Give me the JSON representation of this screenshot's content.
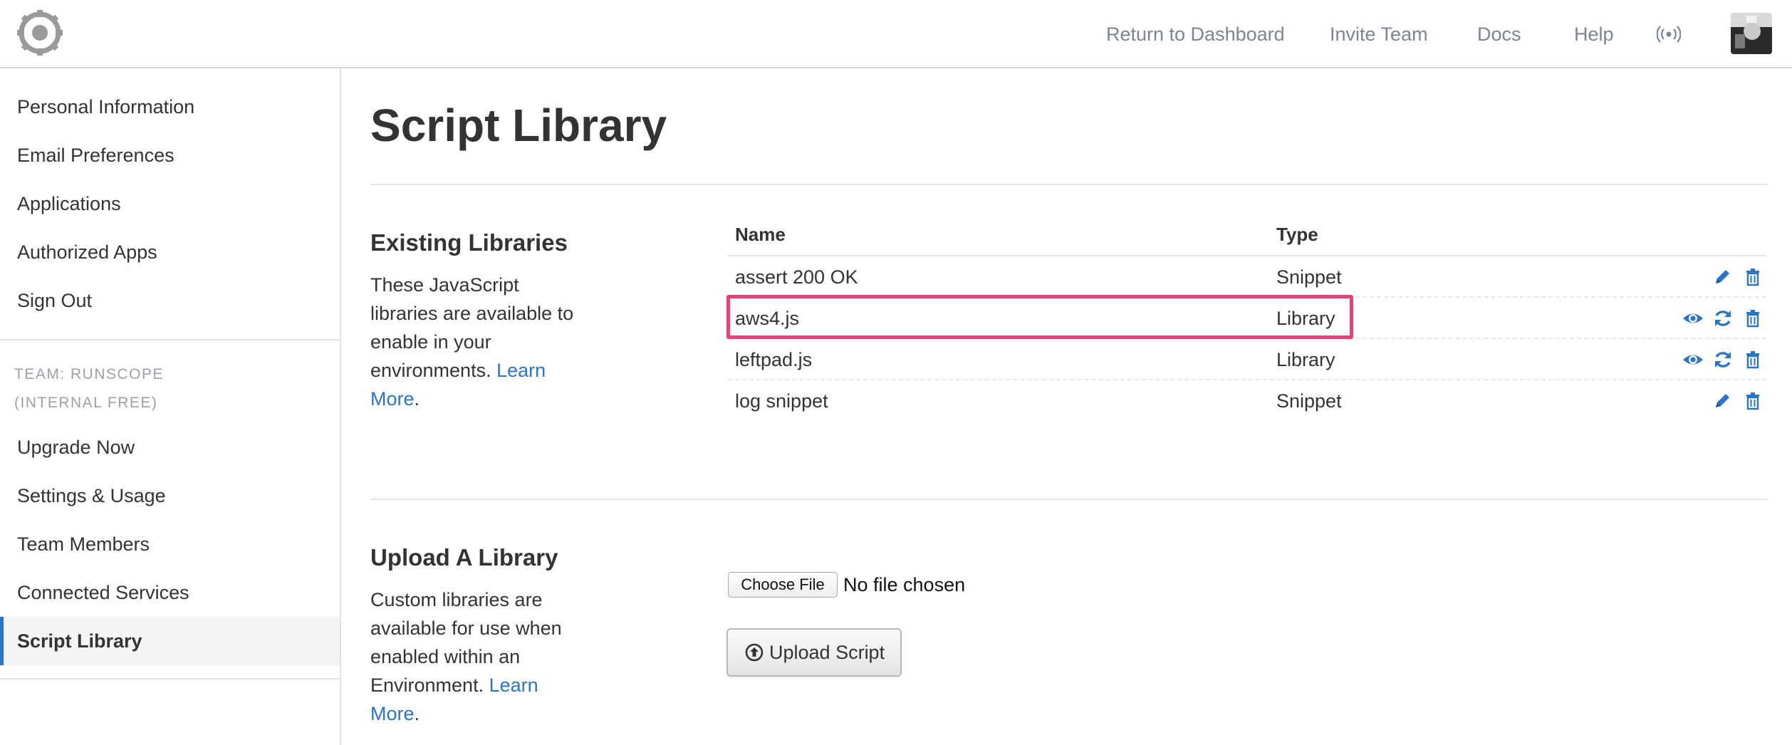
{
  "nav": {
    "links": [
      "Return to Dashboard",
      "Invite Team",
      "Docs",
      "Help"
    ]
  },
  "sidebar": {
    "items_top": [
      "Personal Information",
      "Email Preferences",
      "Applications",
      "Authorized Apps",
      "Sign Out"
    ],
    "team_label_line1": "TEAM: RUNSCOPE",
    "team_label_line2": "(INTERNAL FREE)",
    "items_team": [
      "Upgrade Now",
      "Settings & Usage",
      "Team Members",
      "Connected Services",
      "Script Library"
    ],
    "active_item": "Script Library"
  },
  "page": {
    "title": "Script Library"
  },
  "existing": {
    "title": "Existing Libraries",
    "desc": "These JavaScript libraries are available to enable in your environments.",
    "learn_more": "Learn More",
    "period": "."
  },
  "table": {
    "columns": [
      "Name",
      "Type"
    ],
    "rows": [
      {
        "name": "assert 200 OK",
        "type": "Snippet",
        "actions": [
          "pencil-icon",
          "trash-icon"
        ]
      },
      {
        "name": "aws4.js",
        "type": "Library",
        "actions": [
          "eye-icon",
          "refresh-icon",
          "trash-icon"
        ],
        "highlighted": true
      },
      {
        "name": "leftpad.js",
        "type": "Library",
        "actions": [
          "eye-icon",
          "refresh-icon",
          "trash-icon"
        ]
      },
      {
        "name": "log snippet",
        "type": "Snippet",
        "actions": [
          "pencil-icon",
          "trash-icon"
        ]
      }
    ]
  },
  "upload": {
    "title": "Upload A Library",
    "desc": "Custom libraries are available for use when enabled within an Environment.",
    "learn_more": "Learn More",
    "period": ".",
    "choose_file_label": "Choose File",
    "no_file_text": "No file chosen",
    "upload_button_label": "Upload Script"
  },
  "colors": {
    "accent": "#2a74c9",
    "highlight": "#e83e79",
    "nav_text": "#7b8593",
    "muted": "#9aa1aa"
  }
}
